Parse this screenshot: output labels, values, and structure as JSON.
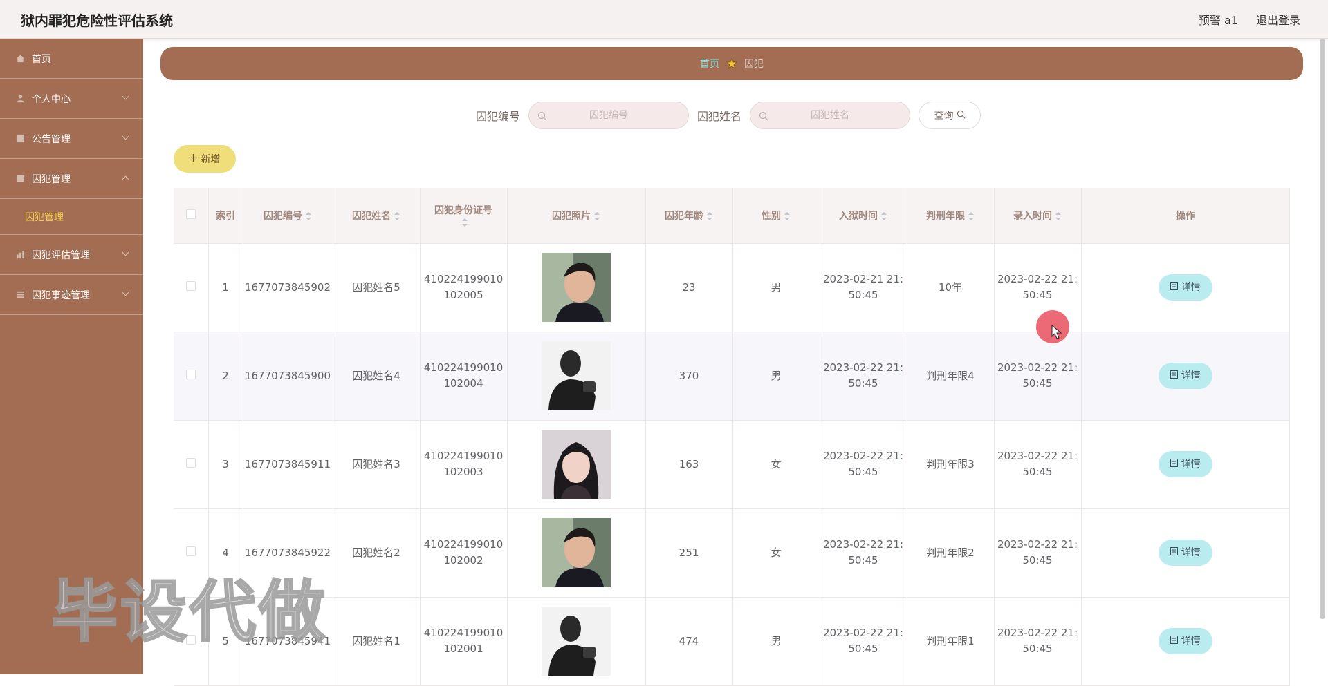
{
  "app": {
    "title": "狱内罪犯危险性评估系统"
  },
  "topbar": {
    "user_label": "预警 a1",
    "logout_label": "退出登录"
  },
  "sidebar": {
    "items": [
      {
        "label": "首页"
      },
      {
        "label": "个人中心"
      },
      {
        "label": "公告管理"
      },
      {
        "label": "囚犯管理",
        "submenu": [
          {
            "label": "囚犯管理"
          }
        ]
      },
      {
        "label": "囚犯评估管理"
      },
      {
        "label": "囚犯事迹管理"
      }
    ]
  },
  "breadcrumb": {
    "home": "首页",
    "current": "囚犯"
  },
  "search": {
    "id_label": "囚犯编号",
    "id_placeholder": "囚犯编号",
    "name_label": "囚犯姓名",
    "name_placeholder": "囚犯姓名",
    "query_label": "查询"
  },
  "toolbar": {
    "add_label": "新增"
  },
  "table": {
    "columns": [
      "索引",
      "囚犯编号",
      "囚犯姓名",
      "囚犯身份证号",
      "囚犯照片",
      "囚犯年龄",
      "性别",
      "入狱时间",
      "判刑年限",
      "录入时间",
      "操作"
    ],
    "rows": [
      {
        "index": "1",
        "number": "1677073845902",
        "name": "囚犯姓名5",
        "id_line1": "410224199010",
        "id_line2": "102005",
        "photo": "man-smiling-photo",
        "age": "23",
        "gender": "男",
        "jail_line1": "2023-02-21 21:",
        "jail_line2": "50:45",
        "term": "10年",
        "entry_line1": "2023-02-22 21:",
        "entry_line2": "50:45",
        "action": "详情"
      },
      {
        "index": "2",
        "number": "1677073845900",
        "name": "囚犯姓名4",
        "id_line1": "410224199010",
        "id_line2": "102004",
        "photo": "man-silhouette-photo",
        "age": "370",
        "gender": "男",
        "jail_line1": "2023-02-22 21:",
        "jail_line2": "50:45",
        "term": "判刑年限4",
        "entry_line1": "2023-02-22 21:",
        "entry_line2": "50:45",
        "action": "详情"
      },
      {
        "index": "3",
        "number": "1677073845911",
        "name": "囚犯姓名3",
        "id_line1": "410224199010",
        "id_line2": "102003",
        "photo": "woman-portrait-photo",
        "age": "163",
        "gender": "女",
        "jail_line1": "2023-02-22 21:",
        "jail_line2": "50:45",
        "term": "判刑年限3",
        "entry_line1": "2023-02-22 21:",
        "entry_line2": "50:45",
        "action": "详情"
      },
      {
        "index": "4",
        "number": "1677073845922",
        "name": "囚犯姓名2",
        "id_line1": "410224199010",
        "id_line2": "102002",
        "photo": "man-smiling-photo",
        "age": "251",
        "gender": "女",
        "jail_line1": "2023-02-22 21:",
        "jail_line2": "50:45",
        "term": "判刑年限2",
        "entry_line1": "2023-02-22 21:",
        "entry_line2": "50:45",
        "action": "详情"
      },
      {
        "index": "5",
        "number": "1677073845941",
        "name": "囚犯姓名1",
        "id_line1": "410224199010",
        "id_line2": "102001",
        "photo": "man-silhouette-photo",
        "age": "474",
        "gender": "男",
        "jail_line1": "2023-02-22 21:",
        "jail_line2": "50:45",
        "term": "判刑年限1",
        "entry_line1": "2023-02-22 21:",
        "entry_line2": "50:45",
        "action": "详情"
      }
    ]
  },
  "watermark": {
    "text": "毕设代做"
  },
  "colors": {
    "sidebar": "#a26d52",
    "accent_yellow": "#f0de7a",
    "detail_button": "#b9ecee",
    "breadcrumb_home": "#7fe3e6"
  }
}
